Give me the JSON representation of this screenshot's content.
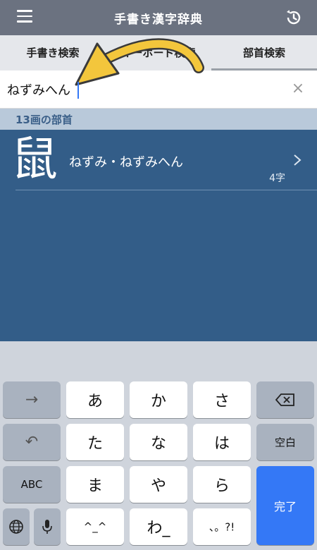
{
  "header": {
    "title": "手書き漢字辞典",
    "menu_icon": "hamburger-menu-icon",
    "history_icon": "history-icon"
  },
  "tabs": [
    {
      "label": "手書き検索"
    },
    {
      "label": "キーボード検索"
    },
    {
      "label": "部首検索"
    }
  ],
  "search": {
    "value": "ねずみへん",
    "clear": "×"
  },
  "section": {
    "title": "13画の部首"
  },
  "results": [
    {
      "kanji": "鼠",
      "name": "ねずみ・ねずみへん",
      "count": "4字"
    }
  ],
  "keyboard": {
    "keys": {
      "arrow": "→",
      "a": "あ",
      "ka": "か",
      "sa": "さ",
      "undo": "↶",
      "ta": "た",
      "na": "な",
      "ha": "は",
      "space": "空白",
      "abc": "ABC",
      "ma": "ま",
      "ya": "や",
      "ra": "ら",
      "done": "完了",
      "emoticon": "^_^",
      "wa": "わ_",
      "punct": "、。?!"
    }
  },
  "colors": {
    "topbar": "#6b7280",
    "results_bg": "#335d88",
    "accent": "#3478f6"
  }
}
